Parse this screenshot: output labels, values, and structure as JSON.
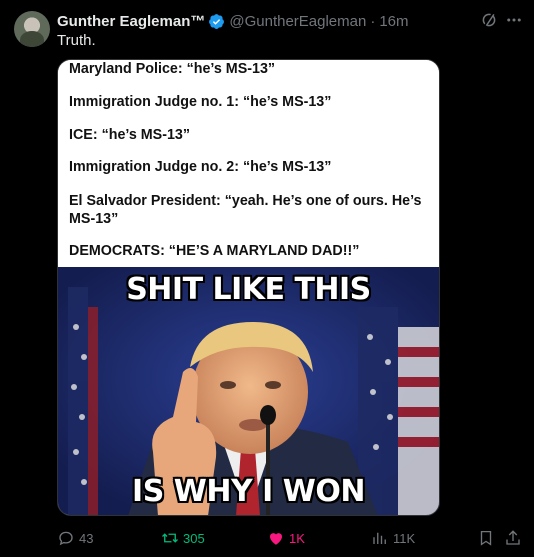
{
  "post": {
    "author_name": "Gunther Eagleman™",
    "handle": "@GuntherEagleman",
    "separator": "·",
    "time": "16m",
    "text": "Truth."
  },
  "quote_panel": {
    "lines": [
      "Maryland Police: “he’s MS-13”",
      "Immigration Judge no. 1:  “he’s MS-13”",
      "ICE:  “he’s MS-13”",
      "Immigration Judge no. 2:  “he’s MS-13”",
      "El Salvador President: “yeah. He’s one of ours. He’s MS-13”",
      "DEMOCRATS:  “HE’S A MARYLAND DAD!!”"
    ]
  },
  "meme": {
    "top_text": "SHIT LIKE THIS",
    "bottom_text": "IS WHY I WON"
  },
  "actions": {
    "replies": "43",
    "reposts": "305",
    "likes": "1K",
    "views": "11K"
  },
  "colors": {
    "background": "#000000",
    "muted": "#71767b",
    "verified": "#1d9bf0",
    "repost": "#00ba7c",
    "like": "#f91880"
  },
  "icons": [
    "verified-badge-icon",
    "grok-icon",
    "more-icon",
    "reply-icon",
    "repost-icon",
    "like-icon",
    "views-icon",
    "bookmark-icon",
    "share-icon"
  ]
}
